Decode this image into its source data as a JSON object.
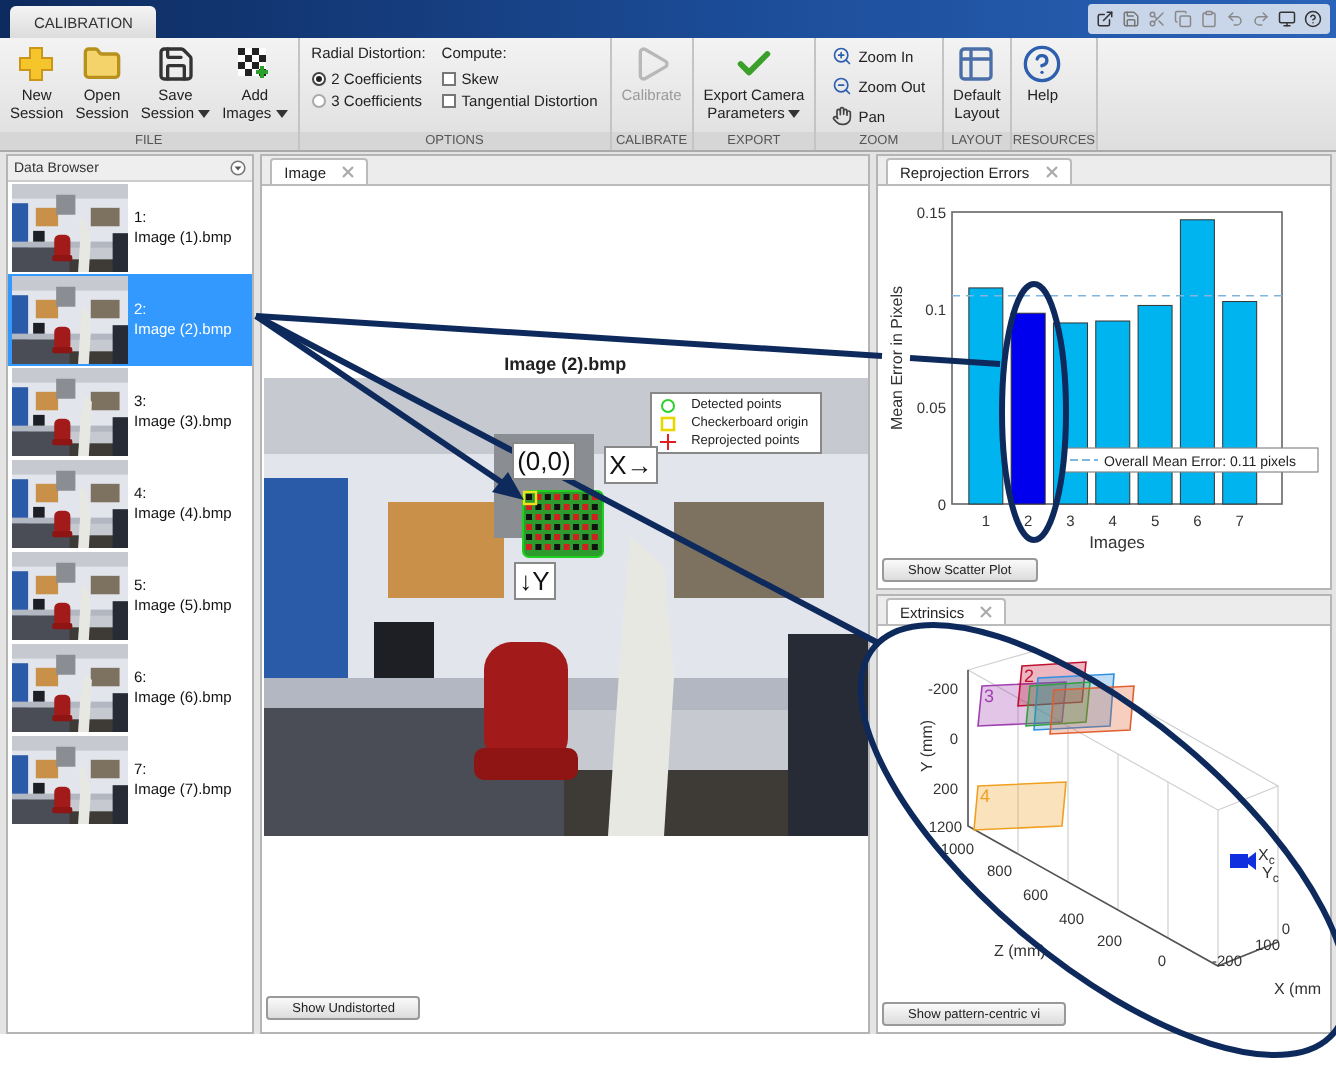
{
  "app_tab": "CALIBRATION",
  "ribbon": [
    {
      "label": "FILE",
      "tools": [
        {
          "kind": "big",
          "label": "New\nSession",
          "dropdown": false,
          "disabled": false
        },
        {
          "kind": "big",
          "label": "Open\nSession",
          "dropdown": false,
          "disabled": false
        },
        {
          "kind": "big",
          "label": "Save\nSession",
          "dropdown": true,
          "disabled": false
        },
        {
          "kind": "big",
          "label": "Add\nImages",
          "dropdown": true,
          "disabled": false
        }
      ]
    },
    {
      "label": "OPTIONS",
      "tools": [
        {
          "kind": "radios",
          "title": "Radial Distortion:",
          "options": [
            {
              "label": "2 Coefficients",
              "selected": true
            },
            {
              "label": "3 Coefficients",
              "selected": false
            }
          ]
        },
        {
          "kind": "checks",
          "title": "Compute:",
          "options": [
            {
              "label": "Skew",
              "checked": false
            },
            {
              "label": "Tangential Distortion",
              "checked": false
            }
          ]
        }
      ]
    },
    {
      "label": "CALIBRATE",
      "tools": [
        {
          "kind": "big",
          "label": "Calibrate",
          "dropdown": false,
          "disabled": true
        }
      ]
    },
    {
      "label": "EXPORT",
      "tools": [
        {
          "kind": "big",
          "label": "Export Camera\nParameters",
          "dropdown": true,
          "disabled": false
        }
      ]
    },
    {
      "label": "ZOOM",
      "tools": [
        {
          "kind": "stack",
          "items": [
            {
              "label": "Zoom In"
            },
            {
              "label": "Zoom Out"
            },
            {
              "label": "Pan"
            }
          ]
        }
      ]
    },
    {
      "label": "LAYOUT",
      "tools": [
        {
          "kind": "big",
          "label": "Default\nLayout",
          "dropdown": false,
          "disabled": false
        }
      ]
    },
    {
      "label": "RESOURCES",
      "tools": [
        {
          "kind": "big",
          "label": "Help",
          "dropdown": false,
          "disabled": false
        }
      ]
    }
  ],
  "data_browser": {
    "title": "Data Browser",
    "items": [
      {
        "index": "1:",
        "name": "Image (1).bmp",
        "selected": false
      },
      {
        "index": "2:",
        "name": "Image (2).bmp",
        "selected": true
      },
      {
        "index": "3:",
        "name": "Image (3).bmp",
        "selected": false
      },
      {
        "index": "4:",
        "name": "Image (4).bmp",
        "selected": false
      },
      {
        "index": "5:",
        "name": "Image (5).bmp",
        "selected": false
      },
      {
        "index": "6:",
        "name": "Image (6).bmp",
        "selected": false
      },
      {
        "index": "7:",
        "name": "Image (7).bmp",
        "selected": false
      }
    ]
  },
  "image_panel": {
    "tab": "Image",
    "title": "Image (2).bmp",
    "legend": [
      {
        "kind": "circle",
        "label": "Detected points"
      },
      {
        "kind": "square",
        "label": "Checkerboard origin"
      },
      {
        "kind": "plus",
        "label": "Reprojected points"
      }
    ],
    "origin_label": "(0,0)",
    "x_axis_label": "X→",
    "y_axis_label": "↓Y",
    "button": "Show Undistorted"
  },
  "reprojection_panel": {
    "tab": "Reprojection Errors",
    "button": "Show Scatter Plot",
    "chart_data": {
      "type": "bar",
      "xlabel": "Images",
      "ylabel": "Mean Error in Pixels",
      "categories": [
        "1",
        "2",
        "3",
        "4",
        "5",
        "6",
        "7"
      ],
      "series": [
        {
          "color": "#00b4f0",
          "values": [
            0.111,
            null,
            0.093,
            0.094,
            0.102,
            0.146,
            0.104
          ]
        },
        {
          "color": "#0000ee",
          "values": [
            null,
            0.098,
            null,
            null,
            null,
            null,
            null
          ]
        }
      ],
      "ylim": [
        0,
        0.15
      ],
      "yticks": [
        0,
        0.05,
        0.1,
        0.15
      ],
      "ref_lines": [
        {
          "axis": "y",
          "value": 0.107,
          "label": "Overall Mean Error: 0.11 pixels"
        }
      ]
    }
  },
  "extrinsics_panel": {
    "tab": "Extrinsics",
    "button": "Show pattern-centric vi",
    "y_label": "Y (mm)",
    "z_label": "Z (mm)",
    "x_label": "X (mm",
    "y_ticks": [
      "-200",
      "0",
      "200"
    ],
    "z_ticks": [
      "1200",
      "1000",
      "800",
      "600",
      "400",
      "200",
      "0"
    ],
    "x_ticks": [
      "-200",
      "100",
      "0"
    ],
    "planes": [
      {
        "label": "3"
      },
      {
        "label": "2"
      },
      {
        "label": "4"
      }
    ],
    "camera_axes": [
      {
        "main": "X",
        "sub": "c"
      },
      {
        "main": "Y",
        "sub": "c"
      }
    ]
  }
}
